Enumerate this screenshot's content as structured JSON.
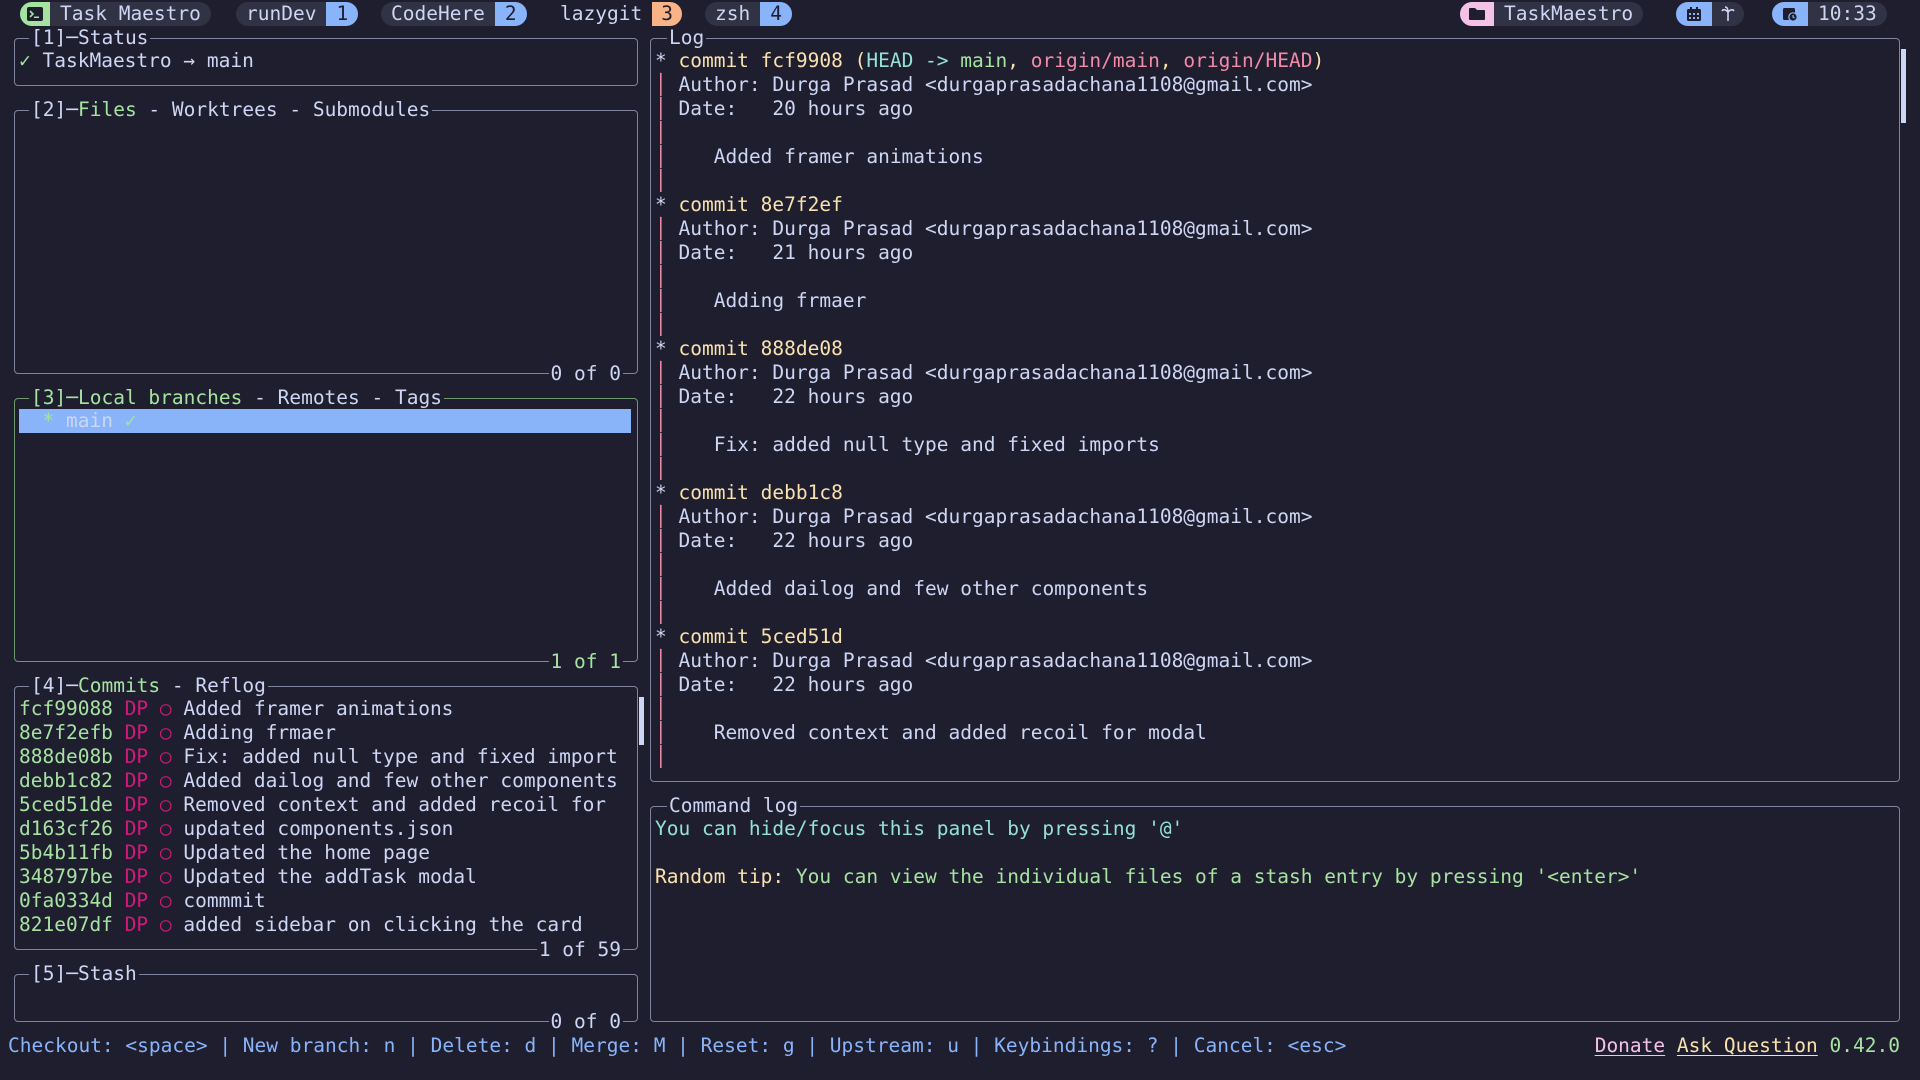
{
  "topbar": {
    "session": {
      "icon": "terminal-icon",
      "label": "Task Maestro"
    },
    "windows": [
      {
        "label": "runDev",
        "index": "1",
        "color": "#89b4fa"
      },
      {
        "label": "CodeHere",
        "index": "2",
        "color": "#89b4fa"
      },
      {
        "label": "lazygit",
        "index": "3",
        "color": "#fab387",
        "active": true
      },
      {
        "label": "zsh",
        "index": "4",
        "color": "#89b4fa"
      }
    ],
    "right": {
      "directory": {
        "icon": "folder-icon",
        "label": "TaskMaestro"
      },
      "calendar": {
        "icon": "calendar-icon",
        "extra_icon": "palm-tree-icon"
      },
      "clock": {
        "icon": "clock-icon",
        "time": "10:33"
      }
    }
  },
  "panels": {
    "status": {
      "title_num": "[1]",
      "title": "Status",
      "check": "✓",
      "repo": "TaskMaestro",
      "arrow": "→",
      "branch": "main"
    },
    "files": {
      "title_num": "[2]",
      "tabs": [
        "Files",
        "Worktrees",
        "Submodules"
      ],
      "footer": "0 of 0"
    },
    "branches": {
      "title_num": "[3]",
      "tabs": [
        "Local branches",
        "Remotes",
        "Tags"
      ],
      "items": [
        {
          "marker": "*",
          "name": "main",
          "check": "✓",
          "selected": true
        }
      ],
      "footer": "1 of 1"
    },
    "commits": {
      "title_num": "[4]",
      "tabs": [
        "Commits",
        "Reflog"
      ],
      "items": [
        {
          "hash": "fcf99088",
          "author": "DP",
          "graph": "○",
          "message": "Added framer animations"
        },
        {
          "hash": "8e7f2efb",
          "author": "DP",
          "graph": "○",
          "message": "Adding frmaer"
        },
        {
          "hash": "888de08b",
          "author": "DP",
          "graph": "○",
          "message": "Fix: added null type and fixed import"
        },
        {
          "hash": "debb1c82",
          "author": "DP",
          "graph": "○",
          "message": "Added dailog and few other components"
        },
        {
          "hash": "5ced51de",
          "author": "DP",
          "graph": "○",
          "message": "Removed context and added recoil for"
        },
        {
          "hash": "d163cf26",
          "author": "DP",
          "graph": "○",
          "message": "updated components.json"
        },
        {
          "hash": "5b4b11fb",
          "author": "DP",
          "graph": "○",
          "message": "Updated the home page"
        },
        {
          "hash": "348797be",
          "author": "DP",
          "graph": "○",
          "message": "Updated the addTask modal"
        },
        {
          "hash": "0fa0334d",
          "author": "DP",
          "graph": "○",
          "message": "commmit"
        },
        {
          "hash": "821e07df",
          "author": "DP",
          "graph": "○",
          "message": "added sidebar on clicking the card"
        }
      ],
      "footer": "1 of 59"
    },
    "stash": {
      "title_num": "[5]",
      "title": "Stash",
      "footer": "0 of 0"
    },
    "log": {
      "title": "Log",
      "commits": [
        {
          "hash": "fcf9908",
          "refs": {
            "head": "HEAD",
            "arrow": "->",
            "branch": "main",
            "remotes": [
              "origin/main",
              "origin/HEAD"
            ]
          },
          "author": "Author: Durga Prasad <durgaprasadachana1108@gmail.com>",
          "date": "Date:   20 hours ago",
          "message": "Added framer animations"
        },
        {
          "hash": "8e7f2ef",
          "author": "Author: Durga Prasad <durgaprasadachana1108@gmail.com>",
          "date": "Date:   21 hours ago",
          "message": "Adding frmaer"
        },
        {
          "hash": "888de08",
          "author": "Author: Durga Prasad <durgaprasadachana1108@gmail.com>",
          "date": "Date:   22 hours ago",
          "message": "Fix: added null type and fixed imports"
        },
        {
          "hash": "debb1c8",
          "author": "Author: Durga Prasad <durgaprasadachana1108@gmail.com>",
          "date": "Date:   22 hours ago",
          "message": "Added dailog and few other components"
        },
        {
          "hash": "5ced51d",
          "author": "Author: Durga Prasad <durgaprasadachana1108@gmail.com>",
          "date": "Date:   22 hours ago",
          "message": "Removed context and added recoil for modal"
        }
      ]
    },
    "command_log": {
      "title": "Command log",
      "line1": "You can hide/focus this panel by pressing '@'",
      "tip_label": "Random tip:",
      "tip_text": "You can view the individual files of a stash entry by pressing '<enter>'"
    }
  },
  "footer": {
    "keybindings": "Checkout: <space> | New branch: n | Delete: d | Merge: M | Reset: g | Upstream: u | Keybindings: ? | Cancel: <esc>",
    "donate": "Donate",
    "ask": "Ask Question",
    "version": "0.42.0"
  }
}
